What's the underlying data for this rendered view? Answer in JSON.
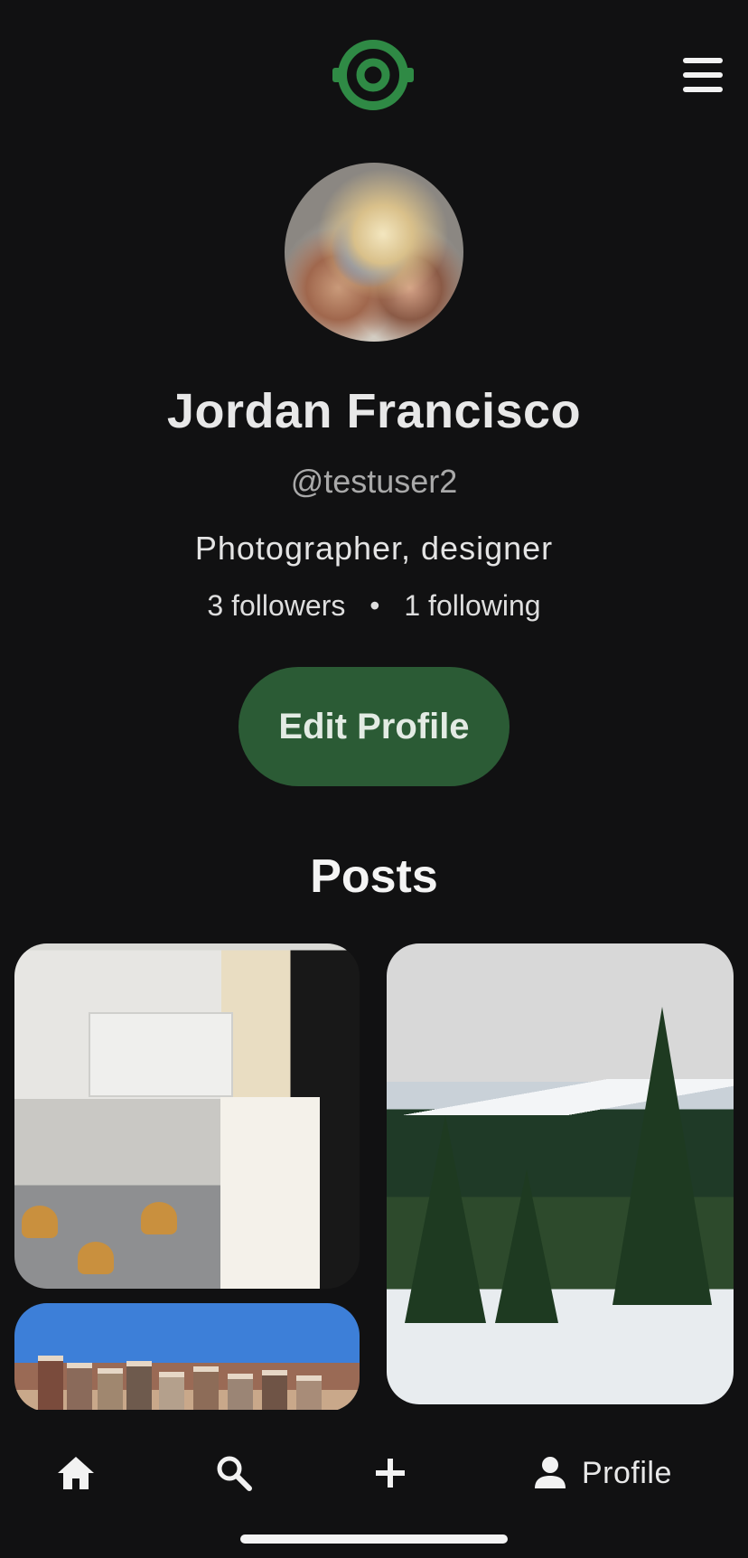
{
  "header": {
    "logo_icon": "ring-logo-icon",
    "menu_icon": "hamburger-menu-icon"
  },
  "profile": {
    "name": "Jordan Francisco",
    "handle": "@testuser2",
    "bio": "Photographer, designer",
    "followers": "3 followers",
    "separator": "•",
    "following": "1 following",
    "edit_button": "Edit Profile"
  },
  "posts": {
    "title": "Posts",
    "items": [
      {
        "name": "classroom-photo"
      },
      {
        "name": "mountain-photo"
      },
      {
        "name": "city-buildings-photo"
      }
    ]
  },
  "bottom_nav": {
    "items": [
      {
        "icon": "home-icon",
        "label": ""
      },
      {
        "icon": "search-icon",
        "label": ""
      },
      {
        "icon": "plus-icon",
        "label": ""
      },
      {
        "icon": "person-icon",
        "label": "Profile"
      }
    ]
  },
  "colors": {
    "accent": "#2b5b35",
    "logo": "#2f8a45",
    "background": "#111112"
  }
}
